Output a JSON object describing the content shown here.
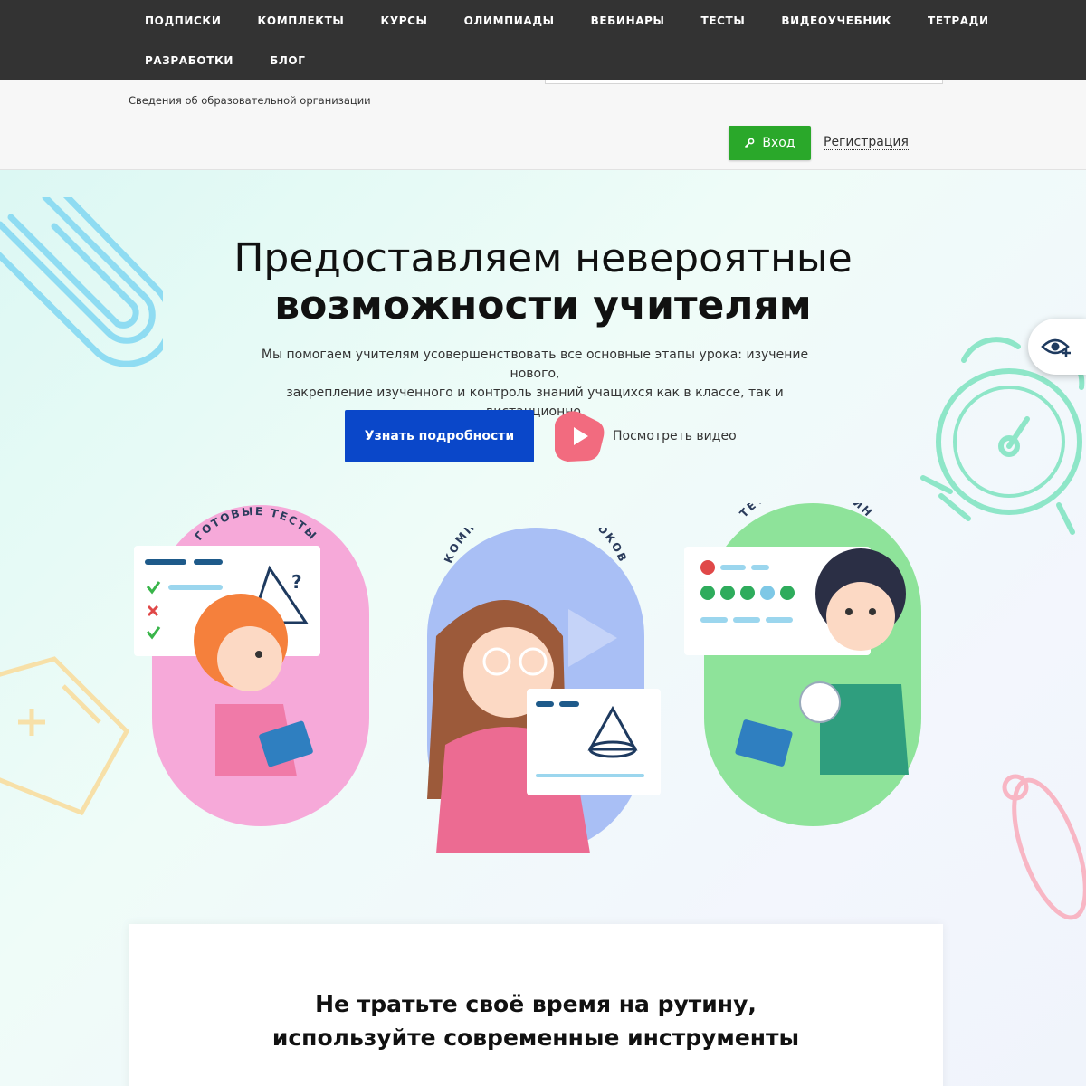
{
  "nav": {
    "row1": [
      "Подписки",
      "Комплекты",
      "Курсы",
      "Олимпиады",
      "Вебинары",
      "Тесты",
      "Видеоучебник",
      "Тетради"
    ],
    "row2": [
      "Разработки",
      "Блог"
    ]
  },
  "header": {
    "org_link": "Сведения об образовательной организации",
    "login_label": "Вход",
    "register_label": "Регистрация"
  },
  "hero": {
    "title_line1": "Предоставляем невероятные",
    "title_line2": "возможности учителям",
    "subtitle_line1": "Мы помогаем учителям усовершенствовать все основные этапы урока: изучение нового,",
    "subtitle_line2": "закрепление изученного и контроль знаний учащихся как в классе, так и дистанционно.",
    "details_button": "Узнать подробности",
    "video_link": "Посмотреть видео"
  },
  "cards": [
    {
      "label": "ГОТОВЫЕ ТЕСТЫ",
      "color": "#f7a8d8"
    },
    {
      "label": "КОМПЛЕКТЫ ВИДЕОУРОКОВ",
      "color": "#a9bff5"
    },
    {
      "label": "ТЕТРАДИ ОНЛАЙН",
      "color": "#8ee39a"
    }
  ],
  "bottom": {
    "title_line1": "Не тратьте своё время на рутину,",
    "title_line2": "используйте современные инструменты"
  },
  "colors": {
    "nav_bg": "#333333",
    "login_green": "#2aa82a",
    "primary_blue": "#0a47c9",
    "play_pink": "#f26b7f"
  },
  "icons": [
    "key-icon",
    "play-icon",
    "eye-plus-icon",
    "paperclip-icon",
    "alarm-clock-icon"
  ]
}
